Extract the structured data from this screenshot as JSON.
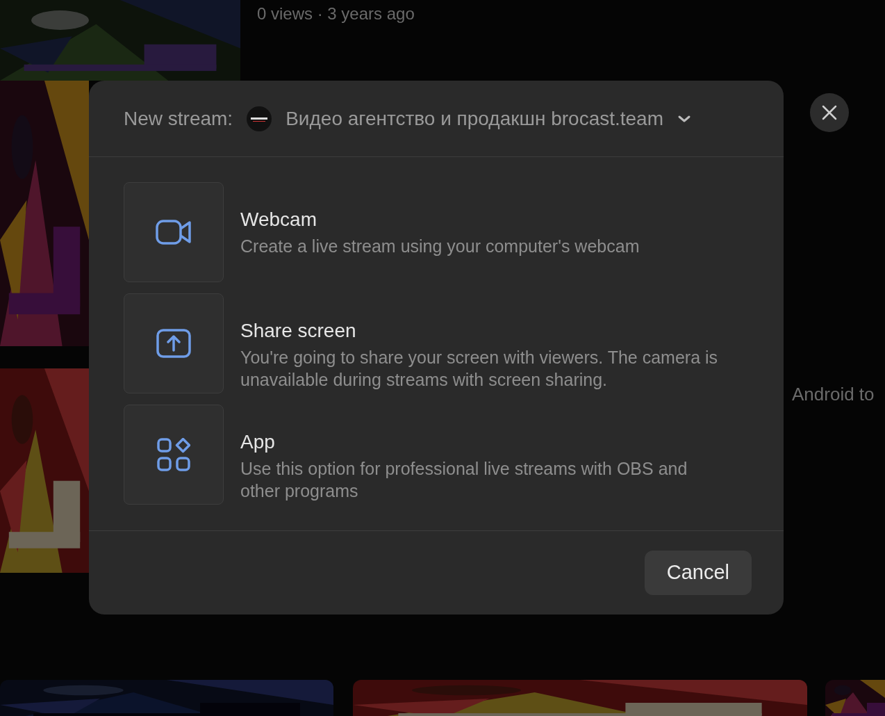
{
  "background": {
    "video_meta": "0 views · 3 years ago",
    "video_title": "Android to"
  },
  "dialog": {
    "title": "New stream:",
    "channel": {
      "name": "Видео агентство и продакшн brocast.team"
    },
    "options": [
      {
        "kind": "webcam",
        "title": "Webcam",
        "description": "Create a live stream using your computer's webcam"
      },
      {
        "kind": "screen",
        "title": "Share screen",
        "description": "You're going to share your screen with viewers. The camera is unavailable during streams with screen sharing."
      },
      {
        "kind": "app",
        "title": "App",
        "description": "Use this option for professional live streams with OBS and other programs"
      }
    ],
    "cancel": "Cancel"
  }
}
